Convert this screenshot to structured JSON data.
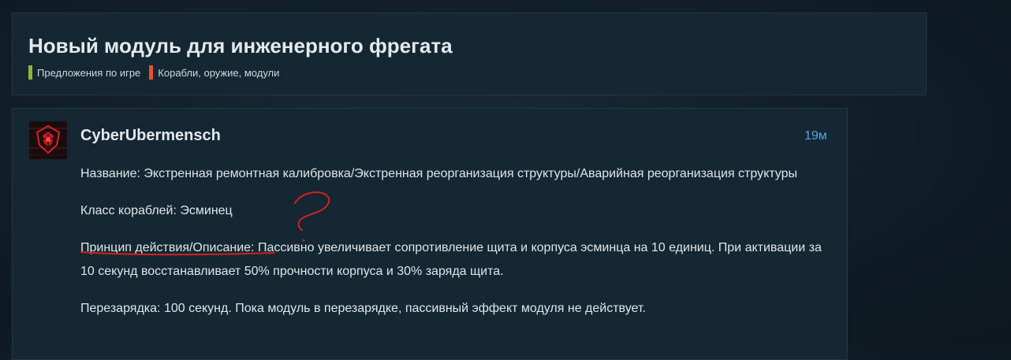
{
  "topic": {
    "title": "Новый модуль для инженерного фрегата",
    "categories": [
      {
        "label": "Предложения по игре",
        "color": "#8bb838"
      },
      {
        "label": "Корабли, оружие, модули",
        "color": "#e8552a"
      }
    ]
  },
  "post": {
    "author": "CyberUbermensch",
    "time": "19м",
    "paragraphs": [
      "Название: Экстренная ремонтная калибровка/Экстренная реорганизация структуры/Аварийная реорганизация структуры",
      "Класс кораблей: Эсминец",
      "Принцип действия/Описание: Пассивно увеличивает сопротивление щита и корпуса эсминца на 10 единиц. При активации за 10 секунд восстанавливает 50% прочности корпуса и 30% заряда щита.",
      "Перезарядка: 100 секунд. Пока модуль в перезарядке, пассивный эффект модуля не действует."
    ]
  },
  "annotation": {
    "color": "#d42020",
    "text": "?"
  }
}
